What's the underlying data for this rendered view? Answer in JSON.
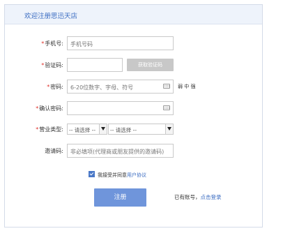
{
  "header": {
    "title": "欢迎注册思迅天店"
  },
  "form": {
    "phone": {
      "label": "手机号:",
      "placeholder": "手机号码"
    },
    "code": {
      "label": "验证码:",
      "value": "",
      "button": "获取验证码"
    },
    "password": {
      "label": "密码:",
      "placeholder": "6-20位数字、字母、符号",
      "strength": "弱 中 强"
    },
    "confirm": {
      "label": "确认密码:",
      "value": ""
    },
    "business": {
      "label": "营业类型:",
      "select1": "-- 请选择 --",
      "select2": "-- 请选择 --"
    },
    "invite": {
      "label": "邀请码:",
      "placeholder": "非必填项(代理商或朋友提供的邀请码)"
    },
    "required_mark": "*"
  },
  "agreement": {
    "text": "我接受并同意",
    "link": "用户协议"
  },
  "submit": {
    "label": "注册"
  },
  "login": {
    "text": "已有账号，",
    "link": "点击登录"
  },
  "colors": {
    "accent": "#3b6cc2",
    "button": "#6f95db",
    "required": "#e0312b"
  }
}
